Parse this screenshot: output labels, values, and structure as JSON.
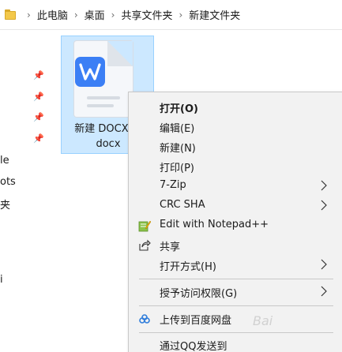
{
  "breadcrumb": {
    "items": [
      "此电脑",
      "桌面",
      "共享文件夹",
      "新建文件夹"
    ]
  },
  "navpane": {
    "partial_items": [
      "le",
      "ots",
      "夹",
      "i"
    ]
  },
  "file": {
    "name_line1": "新建 DOCX 文",
    "name_line2": "docx",
    "icon": "wps-writer-icon",
    "icon_letter": "W",
    "icon_color": "#3b7ff5",
    "selection_color": "#cce8ff"
  },
  "context_menu": {
    "items": [
      {
        "label": "打开(O)",
        "bold": true
      },
      {
        "label": "编辑(E)"
      },
      {
        "label": "新建(N)"
      },
      {
        "label": "打印(P)"
      },
      {
        "label": "7-Zip",
        "submenu": true
      },
      {
        "label": "CRC SHA",
        "submenu": true
      },
      {
        "label": "Edit with Notepad++",
        "icon": "notepadpp-icon"
      },
      {
        "label": "共享",
        "icon": "share-icon"
      },
      {
        "label": "打开方式(H)",
        "submenu": true
      },
      {
        "label": "授予访问权限(G)",
        "submenu": true
      },
      {
        "label": "上传到百度网盘",
        "icon": "baidu-netdisk-icon"
      },
      {
        "label": "通过QQ发送到"
      }
    ]
  },
  "watermark": "Bai"
}
